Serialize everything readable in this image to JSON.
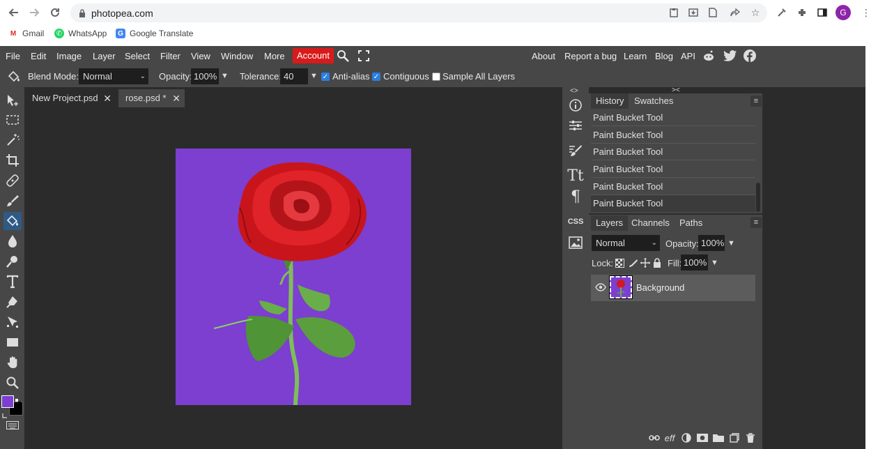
{
  "browser": {
    "url": "photopea.com",
    "bookmarks": [
      {
        "label": "Gmail",
        "icon": "gmail-icon"
      },
      {
        "label": "WhatsApp",
        "icon": "whatsapp-icon"
      },
      {
        "label": "Google Translate",
        "icon": "google-translate-icon"
      }
    ],
    "avatar_letter": "G"
  },
  "menubar": {
    "items": [
      "File",
      "Edit",
      "Image",
      "Layer",
      "Select",
      "Filter",
      "View",
      "Window",
      "More"
    ],
    "account": "Account",
    "right_links": [
      "About",
      "Report a bug",
      "Learn",
      "Blog",
      "API"
    ]
  },
  "tool_options": {
    "blend_mode_label": "Blend Mode:",
    "blend_mode_value": "Normal",
    "opacity_label": "Opacity:",
    "opacity_value": "100%",
    "tolerance_label": "Tolerance:",
    "tolerance_value": "40",
    "anti_alias_label": "Anti-alias",
    "anti_alias_checked": true,
    "contiguous_label": "Contiguous",
    "contiguous_checked": true,
    "sample_all_label": "Sample All Layers",
    "sample_all_checked": false
  },
  "doc_tabs": [
    {
      "label": "New Project.psd"
    },
    {
      "label": "rose.psd *"
    }
  ],
  "canvas": {
    "background_color": "#7c3fcf"
  },
  "colors": {
    "foreground": "#7c3fcf",
    "background": "#000000",
    "accent_account": "#d91a1a"
  },
  "history_panel": {
    "tabs": [
      "History",
      "Swatches"
    ],
    "items": [
      "Paint Bucket Tool",
      "Paint Bucket Tool",
      "Paint Bucket Tool",
      "Paint Bucket Tool",
      "Paint Bucket Tool",
      "Paint Bucket Tool"
    ]
  },
  "layers_panel": {
    "tabs": [
      "Layers",
      "Channels",
      "Paths"
    ],
    "blend_mode": "Normal",
    "opacity_label": "Opacity:",
    "opacity_value": "100%",
    "lock_label": "Lock:",
    "fill_label": "Fill:",
    "fill_value": "100%",
    "layers": [
      {
        "name": "Background",
        "visible": true
      }
    ],
    "footer_icons": [
      "link-icon",
      "effects-icon",
      "adjustment-icon",
      "mask-icon",
      "folder-icon",
      "new-layer-icon",
      "trash-icon"
    ],
    "footer_eff_text": "eff"
  },
  "right_strip": {
    "css_label": "CSS"
  }
}
